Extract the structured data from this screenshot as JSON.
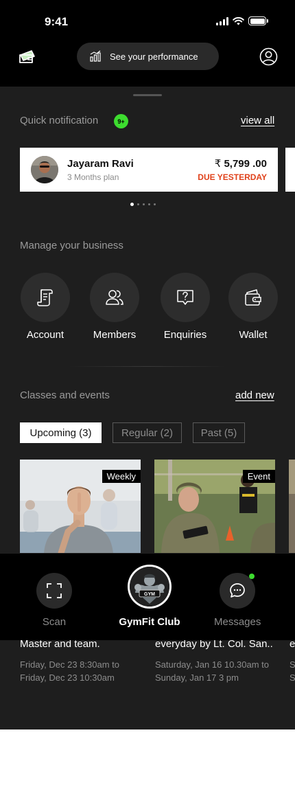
{
  "status": {
    "time": "9:41"
  },
  "header": {
    "performance_label": "See your performance"
  },
  "notifications": {
    "title": "Quick notification",
    "badge": "9+",
    "view_all": "view all",
    "items": [
      {
        "name": "Jayaram Ravi",
        "plan": "3 Months plan",
        "currency": "₹",
        "amount": "5,799 .00",
        "status": "DUE YESTERDAY"
      }
    ],
    "pager_total": 5,
    "pager_active": 1
  },
  "business": {
    "title": "Manage your business",
    "items": [
      {
        "label": "Account",
        "icon": "receipt-icon"
      },
      {
        "label": "Members",
        "icon": "users-icon"
      },
      {
        "label": "Enquiries",
        "icon": "question-chat-icon"
      },
      {
        "label": "Wallet",
        "icon": "wallet-icon"
      }
    ]
  },
  "classes": {
    "title": "Classes and events",
    "add_new": "add new",
    "tabs": [
      {
        "label": "Upcoming (3)",
        "active": true
      },
      {
        "label": "Regular (2)",
        "active": false
      },
      {
        "label": "Past (5)",
        "active": false
      }
    ],
    "events": [
      {
        "tag": "Weekly",
        "title": "Master and team.",
        "time_line1": "Friday, Dec 23 8:30am to",
        "time_line2": "Friday, Dec 23 10:30am"
      },
      {
        "tag": "Event",
        "title": "everyday by Lt. Col. San..",
        "time_line1": "Saturday, Jan 16 10.30am to",
        "time_line2": "Sunday, Jan 17 3 pm"
      },
      {
        "tag": "",
        "title": "e",
        "time_line1": "S",
        "time_line2": "S"
      }
    ]
  },
  "bottom_nav": {
    "scan": "Scan",
    "club": "GymFit Club",
    "messages": "Messages",
    "logo_text": "GYM"
  },
  "colors": {
    "accent_green": "#3ddc2f",
    "due_red": "#e0411a",
    "background": "#1e1e1e"
  }
}
